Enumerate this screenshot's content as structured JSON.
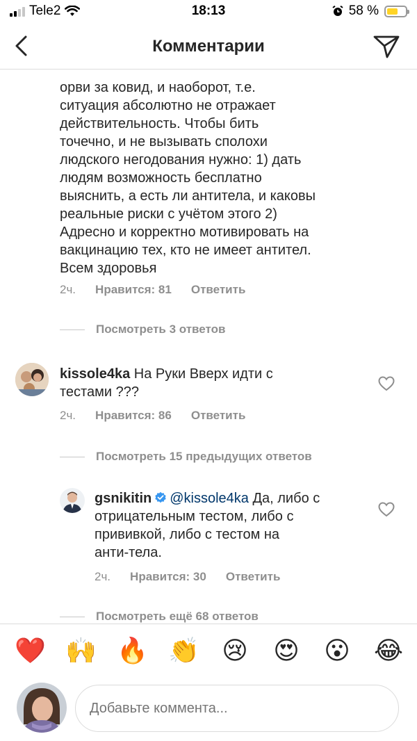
{
  "status_bar": {
    "carrier": "Tele2",
    "time": "18:13",
    "battery": "58 %",
    "battery_level": 0.58,
    "signal_bars": 2
  },
  "header": {
    "title": "Комментарии",
    "back_icon": "chevron-left-icon",
    "direct_icon": "paper-plane-icon"
  },
  "comments": [
    {
      "text_lines": [
        "орви за ковид, и наоборот, т.е.",
        "ситуация абсолютно не отражает",
        "действительность. Чтобы бить",
        "точечно, и не вызывать сполохи",
        "людского негодования нужно: 1) дать",
        "людям возможность бесплатно",
        "выяснить, а есть ли антитела, и каковы",
        "реальные риски с учётом этого 2)",
        "Адресно и корректно мотивировать на",
        "вакцинацию тех, кто не имеет антител.",
        "Всем здоровья"
      ],
      "time": "2ч.",
      "likes": "Нравится: 81",
      "reply": "Ответить",
      "view_replies": "Посмотреть 3 ответов"
    },
    {
      "username": "kissole4ka",
      "text_lines": [
        "На Руки Вверх идти с",
        "тестами ???"
      ],
      "time": "2ч.",
      "likes": "Нравится: 86",
      "reply": "Ответить",
      "view_replies": "Посмотреть 15 предыдущих ответов"
    },
    {
      "username": "gsnikitin",
      "mention": "@kissole4ka",
      "text_lines": [
        "Да, либо с",
        "отрицательным тестом, либо с",
        "прививкой, либо с тестом на",
        "анти-тела."
      ],
      "time": "2ч.",
      "likes": "Нравится: 30",
      "reply": "Ответить",
      "view_replies": "Посмотреть ещё 68 ответов"
    }
  ],
  "emoji_bar": [
    "❤️",
    "🙌",
    "🔥",
    "👏",
    "😢",
    "😍",
    "😮",
    "😂"
  ],
  "composer": {
    "placeholder": "Добавьте коммента..."
  }
}
